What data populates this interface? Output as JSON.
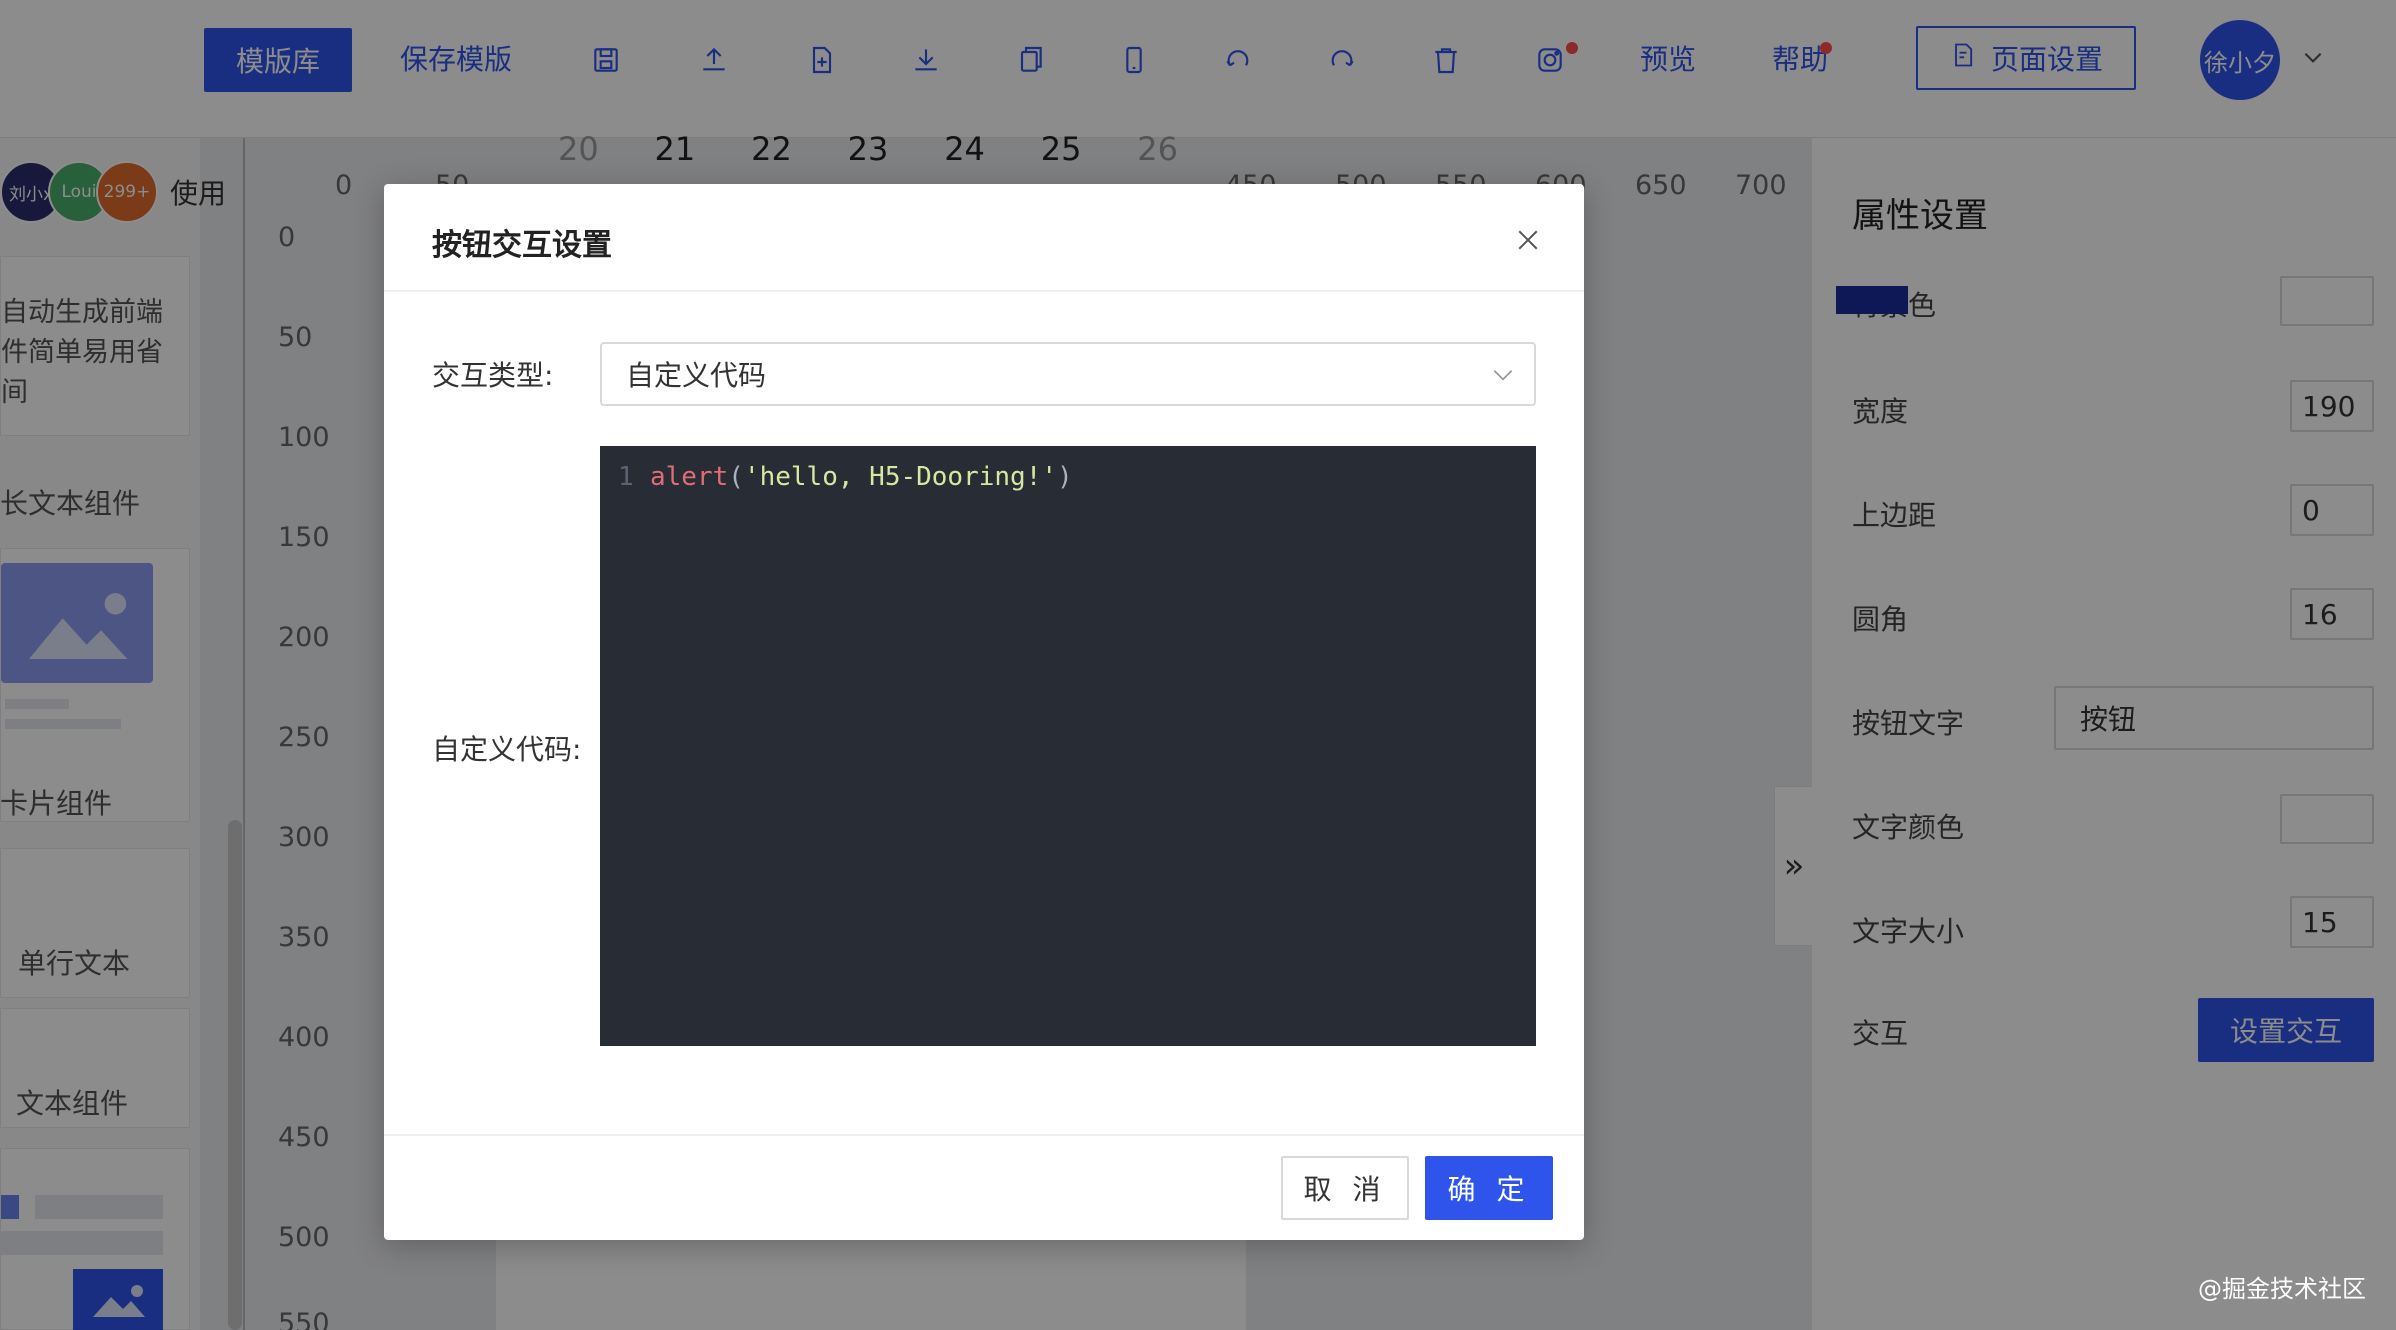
{
  "toolbar": {
    "template_lib": "模版库",
    "save_template": "保存模版",
    "preview": "预览",
    "help": "帮助",
    "page_settings": "页面设置",
    "user_name": "徐小夕",
    "icons": [
      "save-icon",
      "upload-icon",
      "new-file-icon",
      "download-icon",
      "copy-icon",
      "mobile-icon",
      "undo-icon",
      "redo-icon",
      "delete-icon",
      "screenshot-icon"
    ]
  },
  "left_panel": {
    "collaborators": [
      "刘小x",
      "Loui",
      "299+"
    ],
    "use_label": "使用",
    "components": {
      "long_text_desc": "自动生成前端\n件简单易用省\n间",
      "long_text": "长文本组件",
      "card": "卡片组件",
      "single_line": "单行文本",
      "text": "文本组件"
    }
  },
  "rulers": {
    "left": [
      "0",
      "50",
      "100",
      "150",
      "200",
      "250",
      "300",
      "350",
      "400",
      "450",
      "500",
      "550"
    ],
    "top": [
      "0",
      "50",
      "450",
      "500",
      "550",
      "600",
      "650",
      "700"
    ],
    "dates": [
      "20",
      "21",
      "22",
      "23",
      "24",
      "25",
      "26"
    ]
  },
  "properties": {
    "title": "属性设置",
    "bg_color_label": "背景色",
    "bg_color": "#1c2d9e",
    "width_label": "宽度",
    "width_value": "190",
    "margin_top_label": "上边距",
    "margin_top_value": "0",
    "radius_label": "圆角",
    "radius_value": "16",
    "btn_text_label": "按钮文字",
    "btn_text_value": "按钮",
    "text_color_label": "文字颜色",
    "font_size_label": "文字大小",
    "font_size_value": "15",
    "interaction_label": "交互",
    "interaction_button": "设置交互"
  },
  "modal": {
    "title": "按钮交互设置",
    "type_label": "交互类型:",
    "type_value": "自定义代码",
    "code_label": "自定义代码:",
    "code": {
      "line_no": "1",
      "fn": "alert",
      "open": "(",
      "str": "'hello, H5-Dooring!'",
      "close": ")"
    },
    "cancel": "取 消",
    "ok": "确 定"
  },
  "watermark": "@掘金技术社区",
  "colors": {
    "primary": "#2f54eb",
    "editor_bg": "#282c34"
  }
}
